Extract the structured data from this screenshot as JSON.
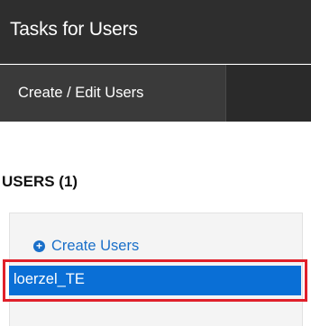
{
  "header": {
    "title": "Tasks for Users"
  },
  "tabs": [
    {
      "label": "Create / Edit Users"
    }
  ],
  "users_section": {
    "heading": "USERS (1)",
    "create_link_label": "Create Users",
    "items": [
      {
        "label": "loerzel_TE",
        "selected": true
      }
    ]
  },
  "colors": {
    "title_bar": "#2e2e2e",
    "tab_active": "#3a3a3a",
    "link": "#1a6fc9",
    "selected_item": "#0a6fd6",
    "highlight_border": "#e0202a"
  },
  "icons": {
    "create": "plus-circle-icon"
  }
}
